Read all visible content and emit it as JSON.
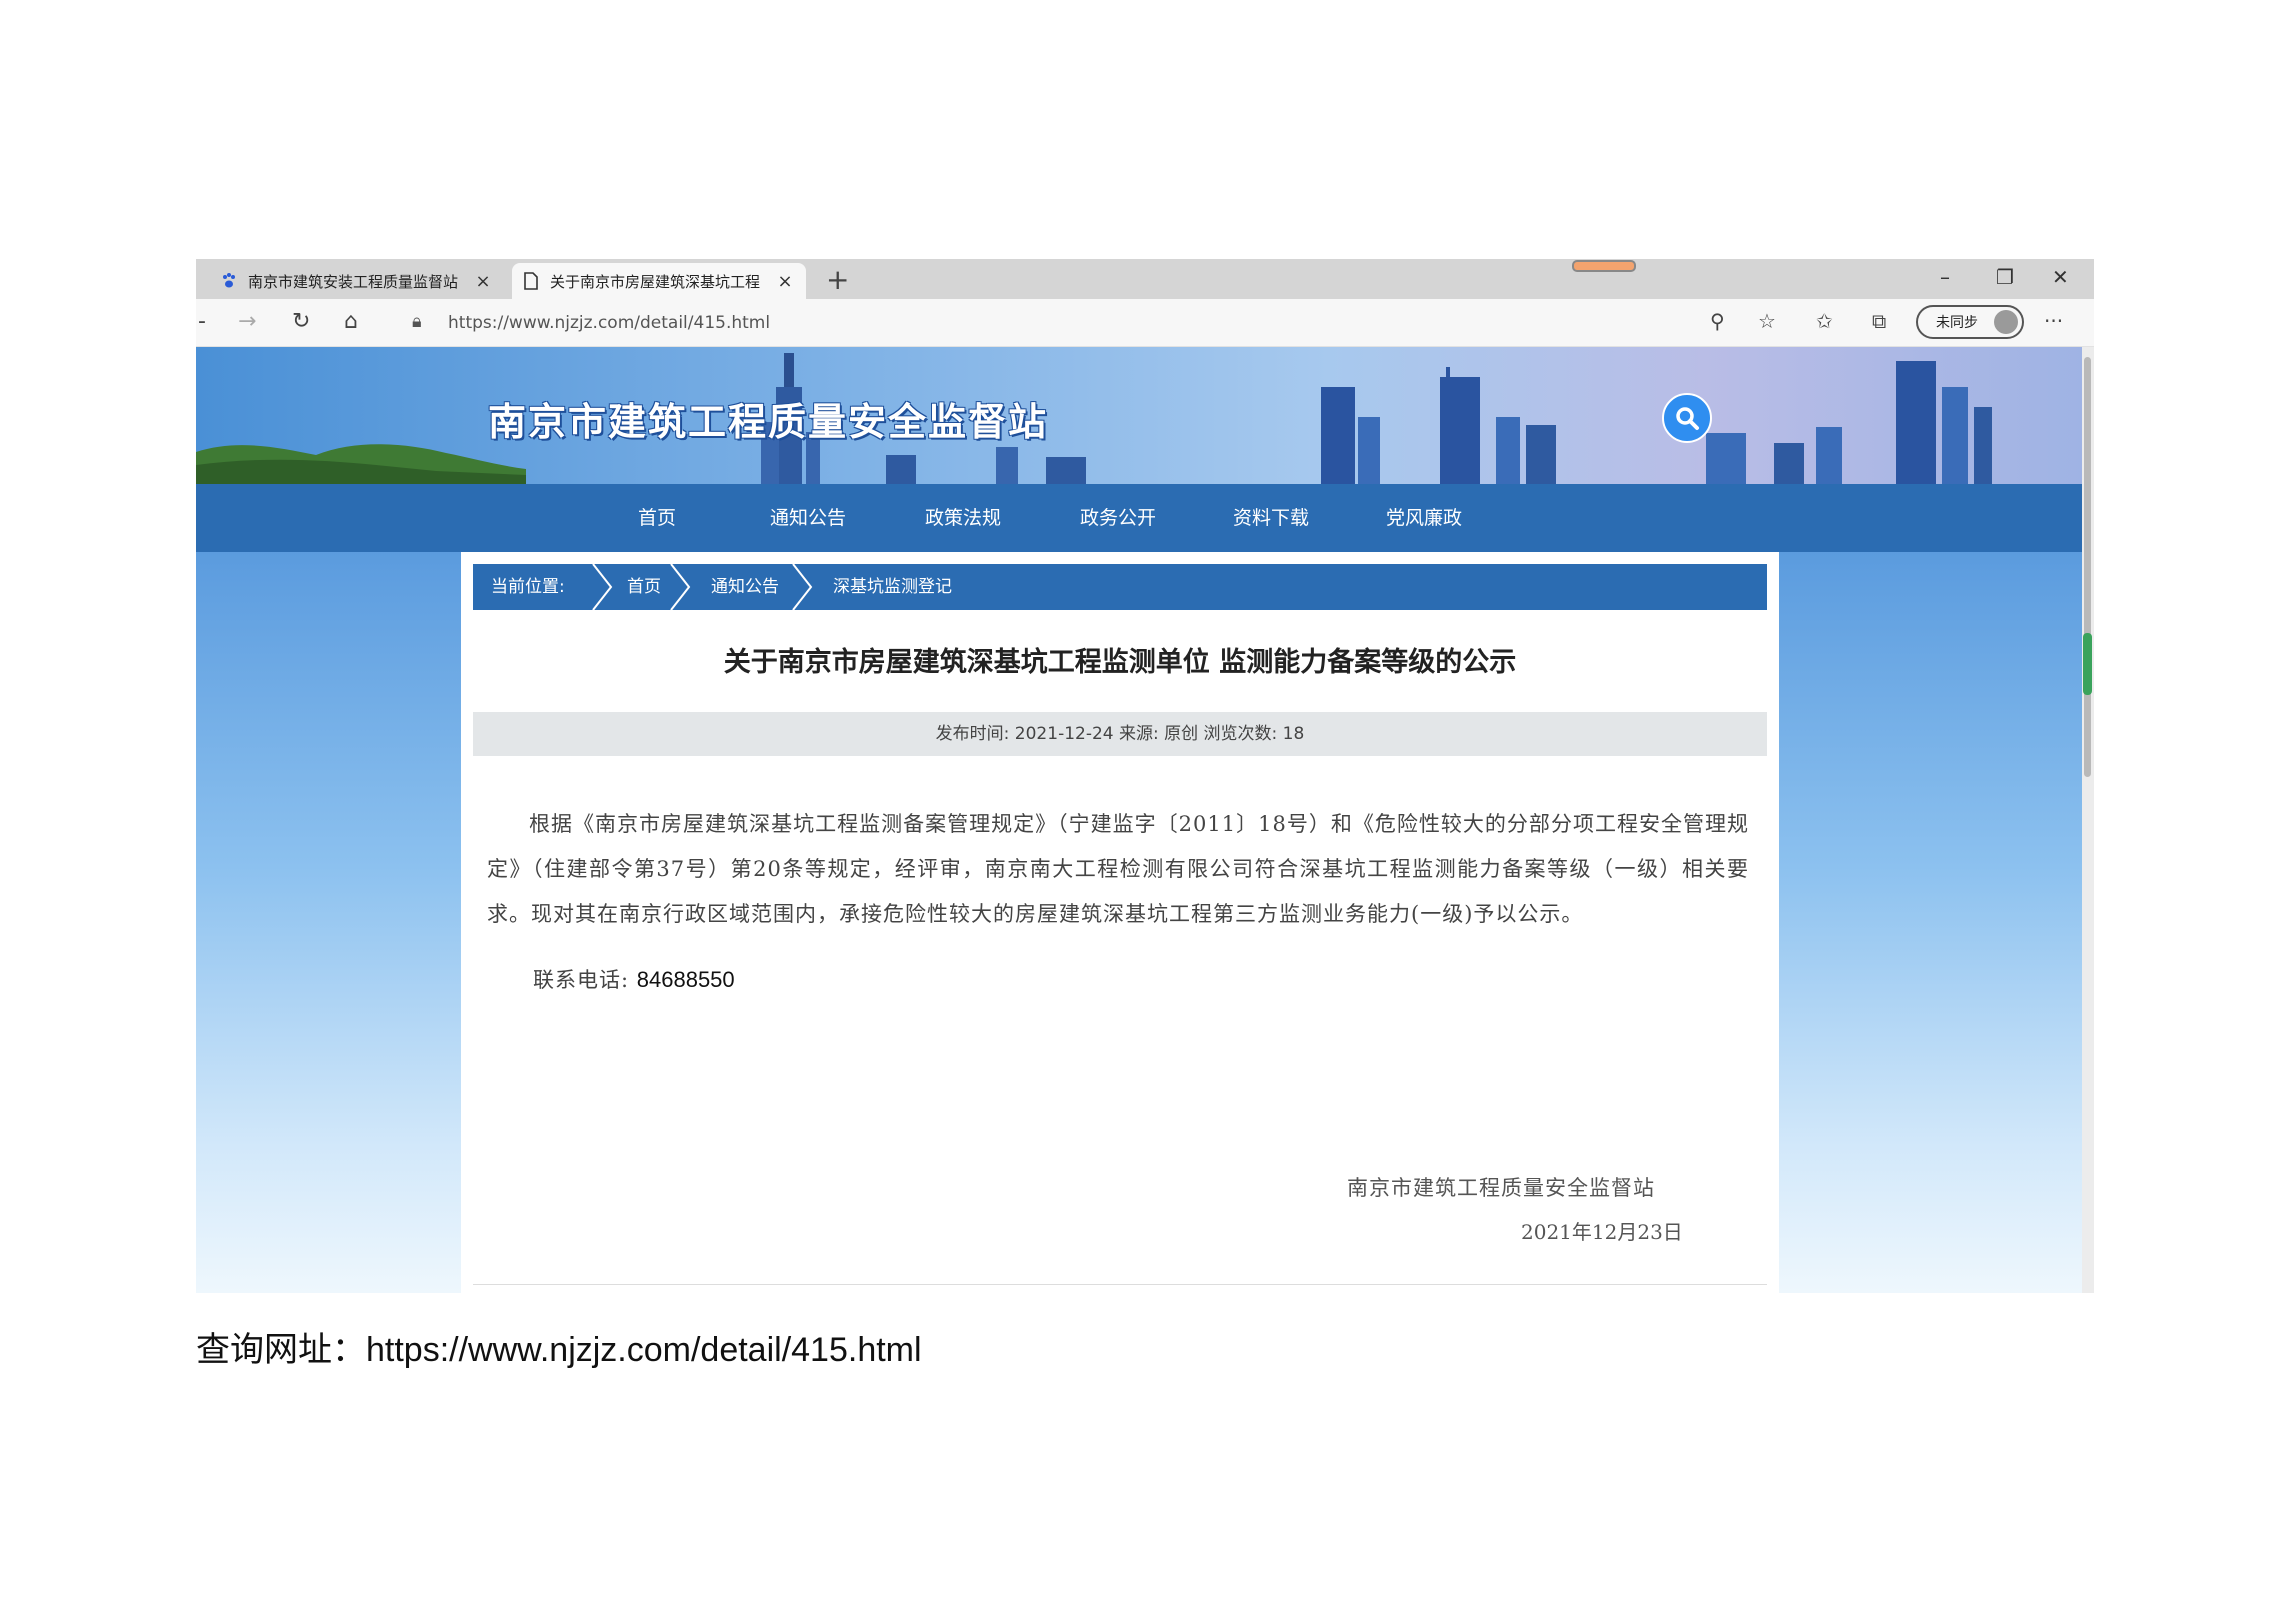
{
  "browser": {
    "tabs": [
      {
        "label": "南京市建筑安装工程质量监督站",
        "icon": "paw-icon",
        "active": false
      },
      {
        "label": "关于南京市房屋建筑深基坑工程",
        "icon": "page-icon",
        "active": true
      }
    ],
    "url": "https://www.njzjz.com/detail/415.html",
    "sync_label": "未同步"
  },
  "site": {
    "title": "南京市建筑工程质量安全监督站",
    "nav": [
      "首页",
      "通知公告",
      "政策法规",
      "政务公开",
      "资料下载",
      "党风廉政"
    ]
  },
  "breadcrumb": {
    "label": "当前位置:",
    "items": [
      "首页",
      "通知公告",
      "深基坑监测登记"
    ]
  },
  "article": {
    "title": "关于南京市房屋建筑深基坑工程监测单位 监测能力备案等级的公示",
    "meta": "发布时间: 2021-12-24  来源: 原创  浏览次数: 18",
    "body": "根据《南京市房屋建筑深基坑工程监测备案管理规定》（宁建监字〔2011〕18号）和《危险性较大的分部分项工程安全管理规定》（住建部令第37号）第20条等规定，经评审，南京南大工程检测有限公司符合深基坑工程监测能力备案等级（一级）相关要求。现对其在南京行政区域范围内，承接危险性较大的房屋建筑深基坑工程第三方监测业务能力(一级)予以公示。",
    "contact_label": "联系电话: ",
    "contact_number": "84688550",
    "signature": "南京市建筑工程质量安全监督站",
    "date": "2021年12月23日"
  },
  "caption": {
    "label": "查询网址：",
    "url": "https://www.njzjz.com/detail/415.html"
  }
}
